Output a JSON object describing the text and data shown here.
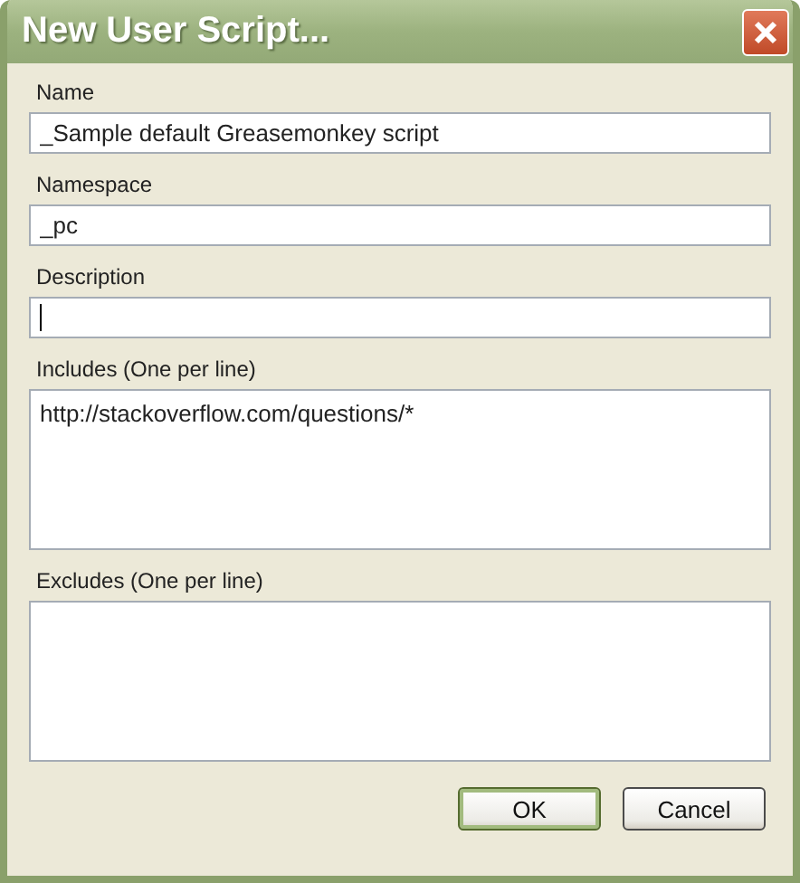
{
  "window": {
    "title": "New User Script..."
  },
  "fields": [
    {
      "kind": "line",
      "label": "Name",
      "value": "_Sample default Greasemonkey script",
      "focused": false
    },
    {
      "kind": "line",
      "label": "Namespace",
      "value": "_pc",
      "focused": false
    },
    {
      "kind": "line",
      "label": "Description",
      "focused": true
    },
    {
      "kind": "area",
      "label": "Includes (One per line)",
      "value": "http://stackoverflow.com/questions/*",
      "focused": false
    },
    {
      "kind": "area",
      "label": "Excludes (One per line)",
      "focused": false
    }
  ],
  "buttons": [
    {
      "label": "OK",
      "default": true
    },
    {
      "label": "Cancel",
      "default": false
    }
  ]
}
